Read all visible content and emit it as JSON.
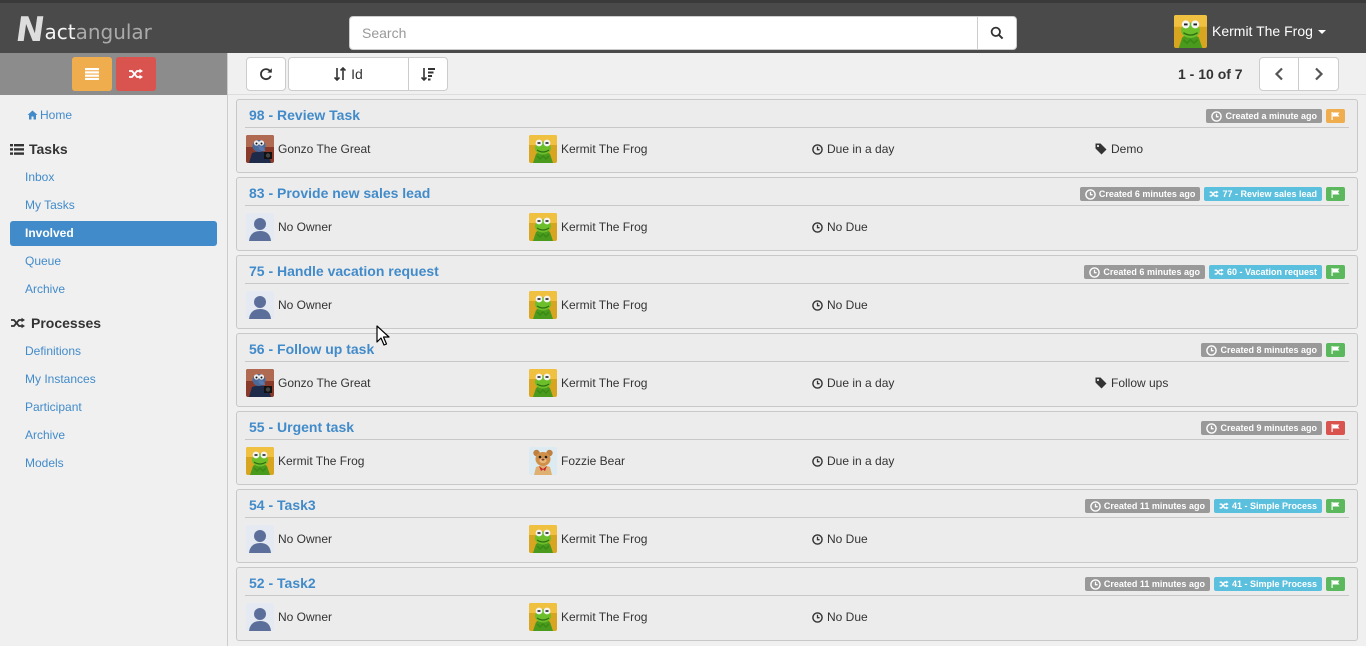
{
  "brand": {
    "n": "N",
    "part1": "act",
    "part2": "angular"
  },
  "search": {
    "placeholder": "Search"
  },
  "user": {
    "name": "Kermit The Frog"
  },
  "sidebar": {
    "home": "Home",
    "tasks_header": "Tasks",
    "tasks_items": [
      "Inbox",
      "My Tasks",
      "Involved",
      "Queue",
      "Archive"
    ],
    "active": "Involved",
    "processes_header": "Processes",
    "process_items": [
      "Definitions",
      "My Instances",
      "Participant",
      "Archive",
      "Models"
    ]
  },
  "toolbar": {
    "sort_field": "Id",
    "pager": "1 - 10 of 7"
  },
  "colors": {
    "primary": "#428bca",
    "warning": "#f0ad4e",
    "danger": "#d9534f",
    "success": "#5cb85c",
    "info": "#5bc0de",
    "label_gray": "#999999"
  },
  "tasks": [
    {
      "title": "98 - Review Task",
      "created": "Created a minute ago",
      "process": "",
      "flag": "orange",
      "owner": "Gonzo The Great",
      "owner_avatar": "gonzo",
      "assignee": "Kermit The Frog",
      "assignee_avatar": "kermit",
      "due": "Due in a day",
      "tag": "Demo"
    },
    {
      "title": "83 - Provide new sales lead",
      "created": "Created 6 minutes ago",
      "process": "77 - Review sales lead",
      "flag": "green",
      "owner": "No Owner",
      "owner_avatar": "none",
      "assignee": "Kermit The Frog",
      "assignee_avatar": "kermit",
      "due": "No Due",
      "tag": ""
    },
    {
      "title": "75 - Handle vacation request",
      "created": "Created 6 minutes ago",
      "process": "60 - Vacation request",
      "flag": "green",
      "owner": "No Owner",
      "owner_avatar": "none",
      "assignee": "Kermit The Frog",
      "assignee_avatar": "kermit",
      "due": "No Due",
      "tag": ""
    },
    {
      "title": "56 - Follow up task",
      "created": "Created 8 minutes ago",
      "process": "",
      "flag": "green",
      "owner": "Gonzo The Great",
      "owner_avatar": "gonzo",
      "assignee": "Kermit The Frog",
      "assignee_avatar": "kermit",
      "due": "Due in a day",
      "tag": "Follow ups"
    },
    {
      "title": "55 - Urgent task",
      "created": "Created 9 minutes ago",
      "process": "",
      "flag": "red",
      "owner": "Kermit The Frog",
      "owner_avatar": "kermit",
      "assignee": "Fozzie Bear",
      "assignee_avatar": "fozzie",
      "due": "Due in a day",
      "tag": ""
    },
    {
      "title": "54 - Task3",
      "created": "Created 11 minutes ago",
      "process": "41 - Simple Process",
      "flag": "green",
      "owner": "No Owner",
      "owner_avatar": "none",
      "assignee": "Kermit The Frog",
      "assignee_avatar": "kermit",
      "due": "No Due",
      "tag": ""
    },
    {
      "title": "52 - Task2",
      "created": "Created 11 minutes ago",
      "process": "41 - Simple Process",
      "flag": "green",
      "owner": "No Owner",
      "owner_avatar": "none",
      "assignee": "Kermit The Frog",
      "assignee_avatar": "kermit",
      "due": "No Due",
      "tag": ""
    }
  ]
}
